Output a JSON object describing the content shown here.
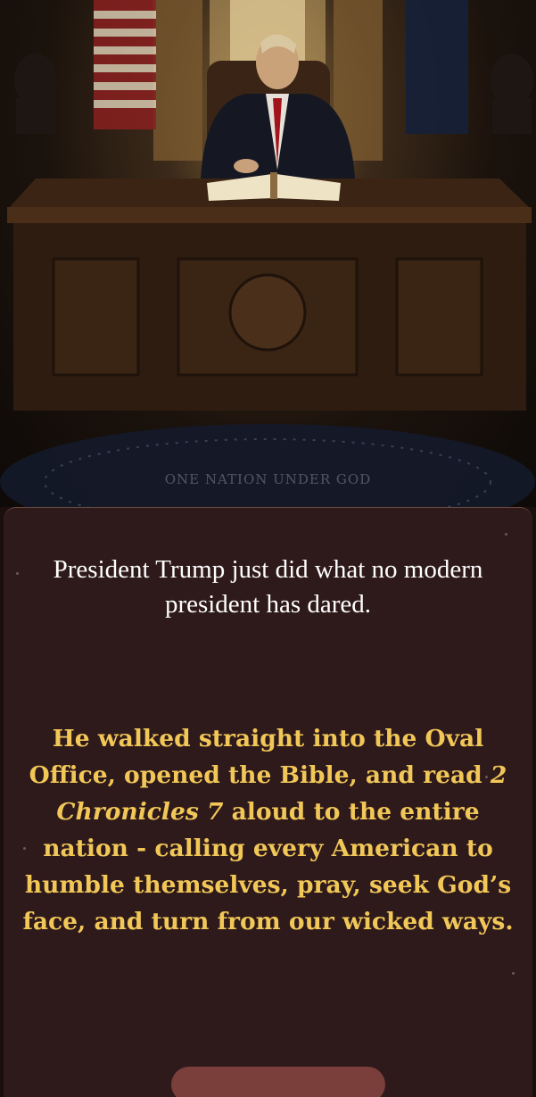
{
  "hero": {
    "motto": "ONE NATION UNDER GOD",
    "image_description": "President seated at Resolute desk reading open Bible in Oval Office"
  },
  "message": {
    "intro": "President Trump just did what no modern president has dared.",
    "highlight_before": "He walked straight into the Oval Office, opened the Bible, and read ",
    "highlight_italic": "2 Chronicles 7",
    "highlight_after": " aloud to the entire nation - calling every American to humble themselves, pray, seek God’s face, and turn from our wicked ways."
  },
  "colors": {
    "card_background": "#2f1a1b",
    "intro_text": "#ffffff",
    "highlight_text": "#f1c758"
  }
}
